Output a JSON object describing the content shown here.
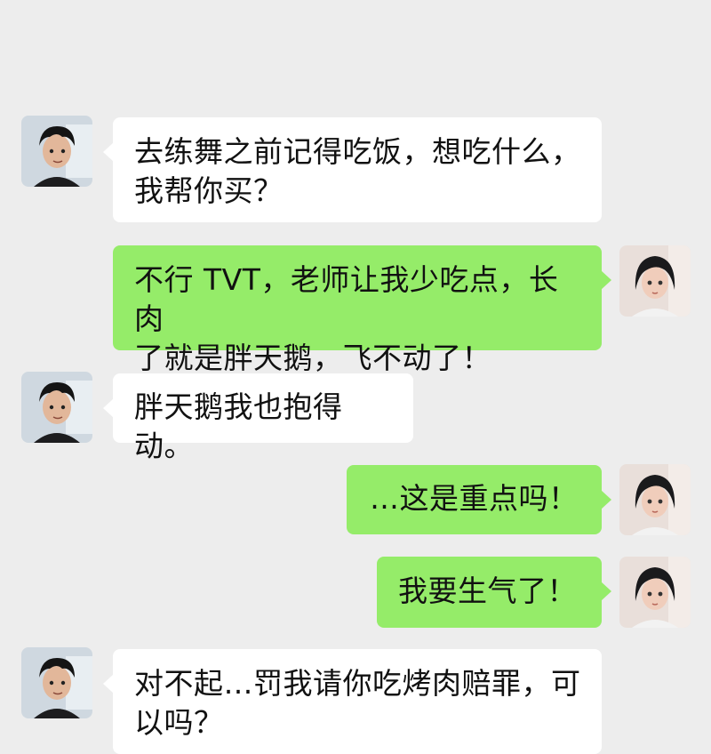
{
  "colors": {
    "background": "#ededed",
    "incoming_bubble": "#ffffff",
    "outgoing_bubble": "#95ec69"
  },
  "messages": [
    {
      "from": "boy",
      "text": "去练舞之前记得吃饭，想吃什么，\n我帮你买？"
    },
    {
      "from": "girl",
      "text": "不行 TVT，老师让我少吃点，长肉\n了就是胖天鹅，飞不动了！"
    },
    {
      "from": "boy",
      "text": "胖天鹅我也抱得动。"
    },
    {
      "from": "girl",
      "text": "…这是重点吗！"
    },
    {
      "from": "girl",
      "text": "我要生气了！"
    },
    {
      "from": "boy",
      "text": "对不起…罚我请你吃烤肉赔罪，可\n以吗？"
    }
  ],
  "avatars": {
    "boy": "boy-avatar-icon",
    "girl": "girl-avatar-icon"
  }
}
